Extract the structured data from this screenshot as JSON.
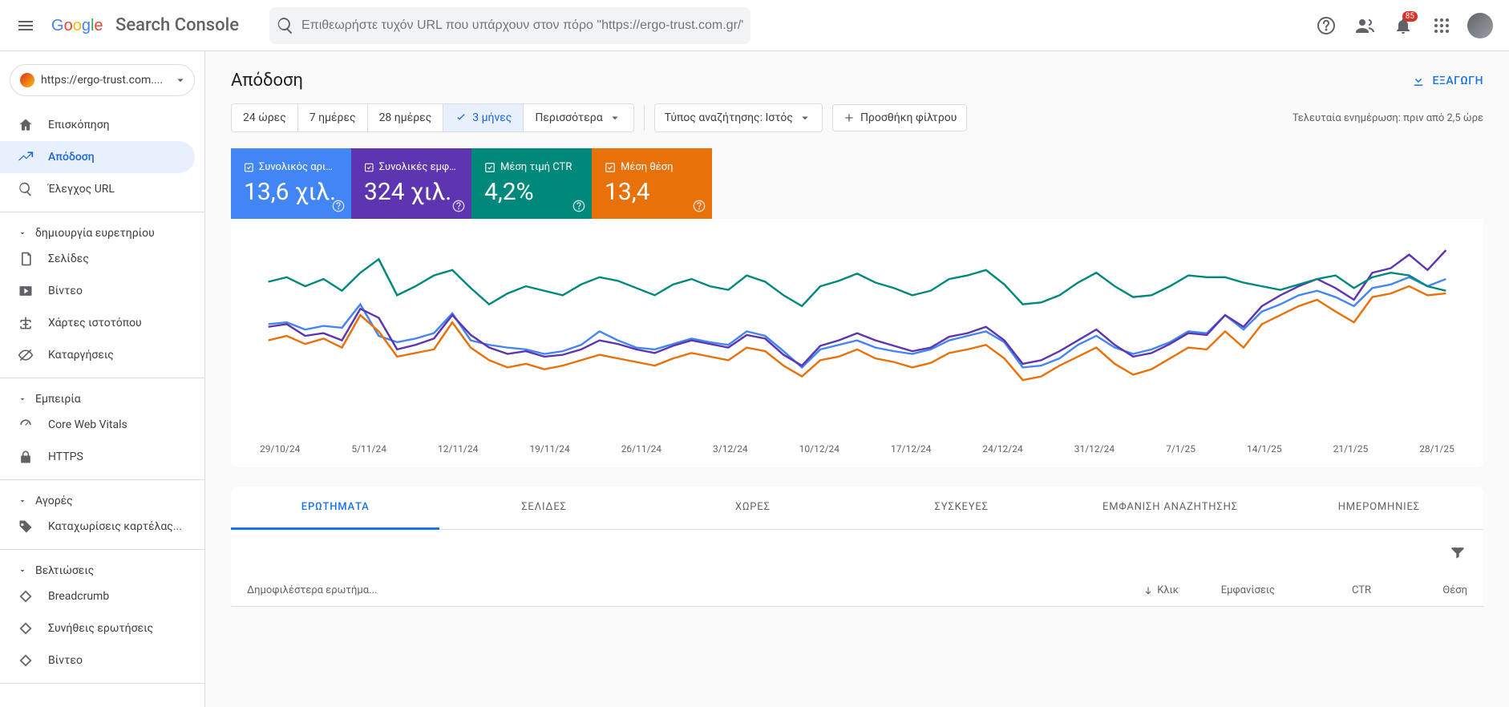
{
  "header": {
    "product_name": "Search Console",
    "search_placeholder": "Επιθεωρήστε τυχόν URL που υπάρχουν στον πόρο \"https://ergo-trust.com.gr/\"",
    "notification_count": "85"
  },
  "sidebar": {
    "property_url": "https://ergo-trust.com....",
    "items_top": [
      {
        "label": "Επισκόπηση",
        "icon": "home"
      },
      {
        "label": "Απόδοση",
        "icon": "trend",
        "active": true
      },
      {
        "label": "Έλεγχος URL",
        "icon": "search"
      }
    ],
    "section_index": "δημιουργία ευρετηρίου",
    "items_index": [
      {
        "label": "Σελίδες",
        "icon": "pages"
      },
      {
        "label": "Βίντεο",
        "icon": "video"
      },
      {
        "label": "Χάρτες ιστοτόπου",
        "icon": "sitemap"
      },
      {
        "label": "Καταργήσεις",
        "icon": "removals"
      }
    ],
    "section_experience": "Εμπειρία",
    "items_experience": [
      {
        "label": "Core Web Vitals",
        "icon": "speed"
      },
      {
        "label": "HTTPS",
        "icon": "lock"
      }
    ],
    "section_shopping": "Αγορές",
    "items_shopping": [
      {
        "label": "Καταχωρίσεις καρτέλας...",
        "icon": "tag"
      }
    ],
    "section_enhancements": "Βελτιώσεις",
    "items_enhancements": [
      {
        "label": "Breadcrumb",
        "icon": "diamond"
      },
      {
        "label": "Συνήθεις ερωτήσεις",
        "icon": "diamond"
      },
      {
        "label": "Βίντεο",
        "icon": "diamond"
      }
    ]
  },
  "page": {
    "title": "Απόδοση",
    "export_label": "ΕΞΑΓΩΓΗ",
    "last_updated": "Τελευταία ενημέρωση: πριν από 2,5 ώρε"
  },
  "filters": {
    "date_ranges": [
      "24 ώρες",
      "7 ημέρες",
      "28 ημέρες",
      "3 μήνες"
    ],
    "date_active_index": 3,
    "more_label": "Περισσότερα",
    "search_type_label": "Τύπος αναζήτησης: Ιστός",
    "add_filter_label": "Προσθήκη φίλτρου"
  },
  "kpis": [
    {
      "label": "Συνολικός αριθμ...",
      "value": "13,6 χιλ.",
      "color": "#4285f4"
    },
    {
      "label": "Συνολικές εμφαν...",
      "value": "324 χιλ.",
      "color": "#5e35b1"
    },
    {
      "label": "Μέση τιμή CTR",
      "value": "4,2%",
      "color": "#00897b"
    },
    {
      "label": "Μέση θέση",
      "value": "13,4",
      "color": "#e8710a"
    }
  ],
  "chart_data": {
    "type": "line",
    "x_labels": [
      "29/10/24",
      "5/11/24",
      "12/11/24",
      "19/11/24",
      "26/11/24",
      "3/12/24",
      "10/12/24",
      "17/12/24",
      "24/12/24",
      "31/12/24",
      "7/1/25",
      "14/1/25",
      "21/1/25",
      "28/1/25"
    ],
    "series": [
      {
        "name": "clicks",
        "color": "#4285f4",
        "values": [
          118,
          120,
          112,
          116,
          114,
          140,
          105,
          98,
          102,
          108,
          130,
          100,
          95,
          92,
          90,
          85,
          88,
          95,
          110,
          100,
          92,
          90,
          96,
          102,
          98,
          95,
          110,
          105,
          88,
          70,
          90,
          95,
          100,
          92,
          88,
          85,
          90,
          100,
          105,
          110,
          98,
          70,
          72,
          80,
          95,
          105,
          92,
          85,
          90,
          98,
          110,
          108,
          128,
          112,
          132,
          140,
          150,
          155,
          148,
          138,
          158,
          162,
          170,
          160,
          168
        ]
      },
      {
        "name": "impressions",
        "color": "#5e35b1",
        "values": [
          115,
          118,
          105,
          108,
          100,
          135,
          125,
          90,
          95,
          102,
          128,
          106,
          92,
          85,
          88,
          82,
          84,
          90,
          100,
          96,
          90,
          86,
          94,
          100,
          96,
          92,
          106,
          102,
          84,
          72,
          94,
          100,
          108,
          100,
          94,
          88,
          92,
          104,
          108,
          115,
          100,
          74,
          78,
          88,
          100,
          112,
          95,
          82,
          86,
          96,
          108,
          106,
          128,
          115,
          138,
          150,
          160,
          168,
          158,
          145,
          175,
          180,
          195,
          178,
          200
        ]
      },
      {
        "name": "ctr",
        "color": "#00897b",
        "values": [
          165,
          170,
          160,
          168,
          155,
          175,
          190,
          150,
          160,
          172,
          178,
          158,
          140,
          152,
          160,
          155,
          150,
          162,
          170,
          166,
          158,
          150,
          162,
          168,
          160,
          156,
          172,
          165,
          150,
          138,
          160,
          166,
          174,
          164,
          158,
          150,
          155,
          168,
          172,
          178,
          162,
          140,
          142,
          150,
          164,
          175,
          160,
          148,
          150,
          160,
          172,
          170,
          170,
          164,
          160,
          156,
          162,
          168,
          172,
          158,
          170,
          175,
          172,
          160,
          155
        ]
      },
      {
        "name": "position",
        "color": "#e8710a",
        "values": [
          100,
          105,
          96,
          102,
          92,
          128,
          110,
          82,
          86,
          90,
          120,
          92,
          78,
          70,
          74,
          68,
          72,
          78,
          84,
          80,
          76,
          72,
          80,
          86,
          82,
          78,
          92,
          88,
          72,
          60,
          78,
          82,
          90,
          80,
          76,
          70,
          75,
          86,
          90,
          95,
          80,
          56,
          60,
          72,
          82,
          92,
          74,
          62,
          68,
          80,
          92,
          90,
          110,
          92,
          118,
          128,
          138,
          145,
          132,
          120,
          148,
          152,
          160,
          150,
          152
        ]
      }
    ]
  },
  "table": {
    "tabs": [
      "ΕΡΩΤΗΜΑΤΑ",
      "ΣΕΛΙΔΕΣ",
      "ΧΩΡΕΣ",
      "ΣΥΣΚΕΥΕΣ",
      "ΕΜΦΑΝΙΣΗ ΑΝΑΖΗΤΗΣΗΣ",
      "ΗΜΕΡΟΜΗΝΙΕΣ"
    ],
    "active_tab": 0,
    "columns": {
      "query": "Δημοφιλέστερα ερωτήμα...",
      "clicks": "Κλικ",
      "impressions": "Εμφανίσεις",
      "ctr": "CTR",
      "position": "Θέση"
    }
  }
}
